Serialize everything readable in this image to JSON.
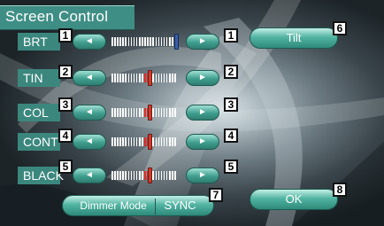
{
  "title": "Screen Control",
  "rows": [
    {
      "label": "BRT",
      "num": "1",
      "level": 0.95
    },
    {
      "label": "TIN",
      "num": "2",
      "level": 0.55
    },
    {
      "label": "COL",
      "num": "3",
      "level": 0.55
    },
    {
      "label": "CONT",
      "num": "4",
      "level": 0.55
    },
    {
      "label": "BLACK",
      "num": "5",
      "level": 0.55
    }
  ],
  "arrows": {
    "left": "◄",
    "right": "►"
  },
  "buttons": {
    "tilt": "Tilt",
    "tilt_num": "6",
    "dimmer": "Dimmer Mode",
    "sync": "SYNC",
    "dimmer_num": "7",
    "ok": "OK",
    "ok_num": "8"
  },
  "colors": {
    "teal": "#3b877d",
    "knob_blue": "#3a5fa8",
    "knob_red": "#d03a2a"
  }
}
